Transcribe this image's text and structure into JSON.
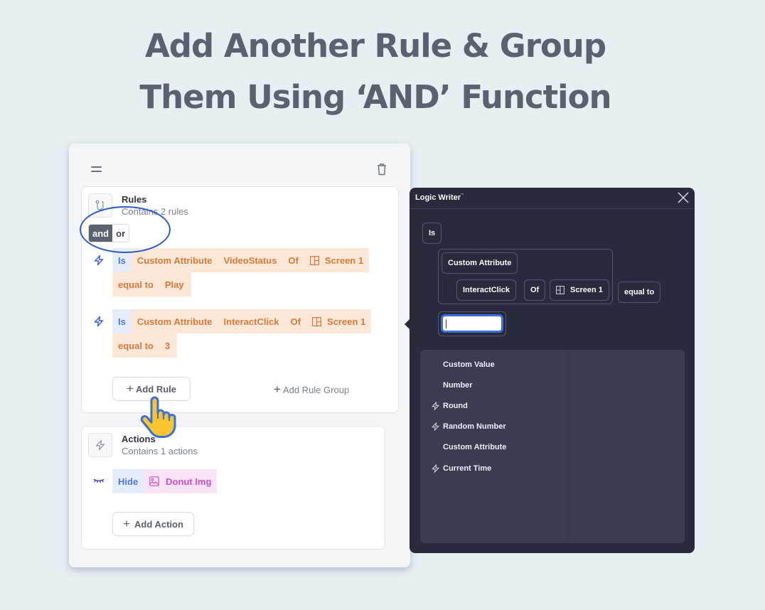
{
  "headline": {
    "line1": "Add Another Rule & Group",
    "line2": "Them Using ‘AND’ Function"
  },
  "card": {
    "drag_icon": "drag-handle-icon",
    "delete_icon": "trash-icon",
    "rules": {
      "icon": "branch-icon",
      "title": "Rules",
      "subtitle": "Contains 2 rules",
      "operator_toggle": {
        "options": [
          "and",
          "or"
        ],
        "selected": "and"
      },
      "items": [
        {
          "icon": "bolt-icon",
          "tokens": [
            "Is",
            "Custom Attribute",
            "VideoStatus",
            "Of",
            "Screen 1",
            "equal to",
            "Play"
          ]
        },
        {
          "icon": "bolt-icon",
          "tokens": [
            "Is",
            "Custom Attribute",
            "InteractClick",
            "Of",
            "Screen 1",
            "equal to",
            "3"
          ]
        }
      ],
      "add_rule_label": "Add Rule",
      "add_rule_group_label": "Add Rule Group"
    },
    "actions": {
      "icon": "bolt-icon",
      "title": "Actions",
      "subtitle": "Contains 1 actions",
      "items": [
        {
          "icon": "eye-closed-icon",
          "verb": "Hide",
          "target_icon": "image-icon",
          "target": "Donut Img"
        }
      ],
      "add_action_label": "Add Action"
    }
  },
  "logic_writer": {
    "title": "Logic Writer",
    "close_icon": "close-icon",
    "expression": {
      "operator": "Is",
      "source": "Custom Attribute",
      "attribute": "InteractClick",
      "of": "Of",
      "screen": "Screen 1",
      "comparison": "equal to",
      "value_input": ""
    },
    "options": [
      {
        "label": "Custom Value",
        "icon": null
      },
      {
        "label": "Number",
        "icon": null
      },
      {
        "label": "Round",
        "icon": "bolt-icon"
      },
      {
        "label": "Random Number",
        "icon": "bolt-icon"
      },
      {
        "label": "Custom Attribute",
        "icon": null
      },
      {
        "label": "Current Time",
        "icon": "bolt-icon"
      }
    ]
  },
  "colors": {
    "background": "#e6f0f3",
    "headline": "#5a6270",
    "rule_token_bg": "#fde8d8",
    "rule_token_text": "#d97a3a",
    "is_token_bg": "#e5edfd",
    "is_token_text": "#4a78e6",
    "logic_writer_bg": "#282a3e",
    "highlight_ellipse": "#2f5bd1",
    "hand_cursor": "#f9c52f"
  }
}
